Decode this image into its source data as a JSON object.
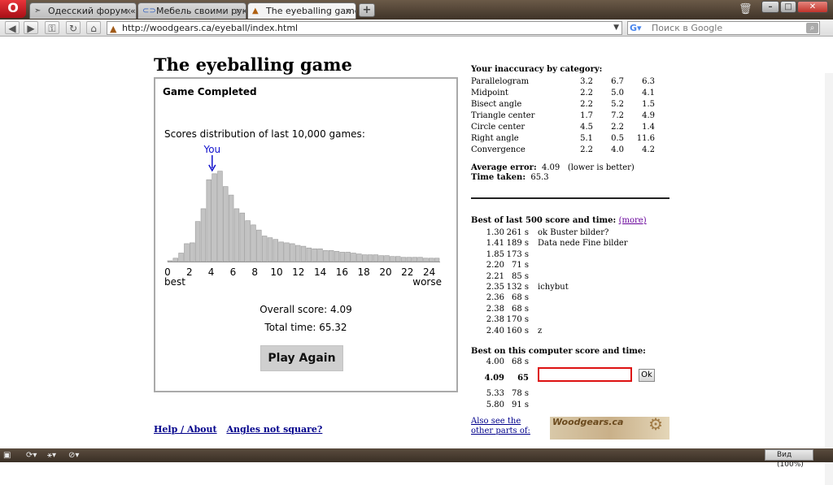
{
  "browser": {
    "opera_logo": "O",
    "tabs": [
      {
        "label": "Одесский форум «Од...",
        "icon": "forum-favicon",
        "active": false
      },
      {
        "label": "Мебель своими рука...",
        "icon": "link-favicon",
        "active": false
      },
      {
        "label": "The eyeballing game",
        "icon": "woodgears-favicon",
        "active": true
      }
    ],
    "tab_close": "x",
    "new_tab": "+",
    "address": "http://woodgears.ca/eyeball/index.html",
    "search_placeholder": "Поиск в Google",
    "zoom_label": "Вид (100%)"
  },
  "page": {
    "title": "The eyeballing game",
    "game": {
      "status": "Game Completed",
      "distribution_label": "Scores distribution of last 10,000 games:",
      "you_label": "You",
      "best_label": "best",
      "worse_label": "worse",
      "overall_score": "Overall score: 4.09",
      "total_time": "Total time: 65.32",
      "play_again": "Play Again"
    },
    "chart_data": {
      "type": "bar",
      "title": "Scores distribution of last 10,000 games:",
      "xlim": [
        0,
        25
      ],
      "x_ticks": [
        "0",
        "2",
        "4",
        "6",
        "8",
        "10",
        "12",
        "14",
        "16",
        "18",
        "20",
        "22",
        "24"
      ],
      "x": [
        0.5,
        1,
        1.5,
        2,
        2.5,
        3,
        3.5,
        4,
        4.5,
        5,
        5.5,
        6,
        6.5,
        7,
        7.5,
        8,
        8.5,
        9,
        9.5,
        10,
        10.5,
        11,
        11.5,
        12,
        12.5,
        13,
        13.5,
        14,
        14.5,
        15,
        15.5,
        16,
        16.5,
        17,
        17.5,
        18,
        18.5,
        19,
        19.5,
        20,
        20.5,
        21,
        21.5,
        22,
        22.5,
        23,
        23.5,
        24,
        24.5
      ],
      "values": [
        1,
        4,
        10,
        21,
        22,
        47,
        62,
        96,
        103,
        106,
        88,
        78,
        62,
        57,
        48,
        43,
        37,
        30,
        28,
        26,
        23,
        22,
        21,
        19,
        18,
        16,
        15,
        15,
        13,
        13,
        12,
        11,
        11,
        10,
        9,
        8,
        8,
        8,
        7,
        7,
        6,
        6,
        5,
        5,
        5,
        5,
        4,
        4,
        4
      ],
      "you_marker": 4.09
    },
    "inaccuracy": {
      "title": "Your inaccuracy by category:",
      "rows": [
        {
          "name": "Parallelogram",
          "v1": "3.2",
          "v2": "6.7",
          "v3": "6.3"
        },
        {
          "name": "Midpoint",
          "v1": "2.2",
          "v2": "5.0",
          "v3": "4.1"
        },
        {
          "name": "Bisect angle",
          "v1": "2.2",
          "v2": "5.2",
          "v3": "1.5"
        },
        {
          "name": "Triangle center",
          "v1": "1.7",
          "v2": "7.2",
          "v3": "4.9"
        },
        {
          "name": "Circle center",
          "v1": "4.5",
          "v2": "2.2",
          "v3": "1.4"
        },
        {
          "name": "Right angle",
          "v1": "5.1",
          "v2": "0.5",
          "v3": "11.6"
        },
        {
          "name": "Convergence",
          "v1": "2.2",
          "v2": "4.0",
          "v3": "4.2"
        }
      ],
      "avg_label": "Average error:",
      "avg_value": "4.09",
      "avg_note": "(lower is better)",
      "time_label": "Time taken:",
      "time_value": "65.3"
    },
    "best500": {
      "title": "Best of last 500 score and time:",
      "more_link": "(more)",
      "rows": [
        {
          "score": "1.30",
          "time": "261 s",
          "name": "ok Buster bilder?"
        },
        {
          "score": "1.41",
          "time": "189 s",
          "name": "Data nede Fine bilder"
        },
        {
          "score": "1.85",
          "time": "173 s",
          "name": ""
        },
        {
          "score": "2.20",
          "time": "71 s",
          "name": ""
        },
        {
          "score": "2.21",
          "time": "85 s",
          "name": ""
        },
        {
          "score": "2.35",
          "time": "132 s",
          "name": "ichybut"
        },
        {
          "score": "2.36",
          "time": "68 s",
          "name": ""
        },
        {
          "score": "2.38",
          "time": "68 s",
          "name": ""
        },
        {
          "score": "2.38",
          "time": "170 s",
          "name": ""
        },
        {
          "score": "2.40",
          "time": "160 s",
          "name": "z"
        }
      ]
    },
    "best_computer": {
      "title": "Best on this computer score and time:",
      "rows": [
        {
          "score": "4.00",
          "time": "68 s",
          "current": false
        },
        {
          "score": "4.09",
          "time": "65",
          "current": true
        },
        {
          "score": "5.33",
          "time": "78 s",
          "current": false
        },
        {
          "score": "5.80",
          "time": "91 s",
          "current": false
        }
      ],
      "ok_label": "Ok"
    },
    "footer": {
      "help_link": "Help / About",
      "angles_link": "Angles not square?",
      "also_see_1": "Also see the",
      "also_see_2": "other parts of:",
      "banner": "Woodgears.ca"
    }
  },
  "colors": {
    "you_marker": "#1010cc",
    "bar_fill": "#c3c3c3",
    "input_border": "#dd1111",
    "link": "#00008b"
  }
}
